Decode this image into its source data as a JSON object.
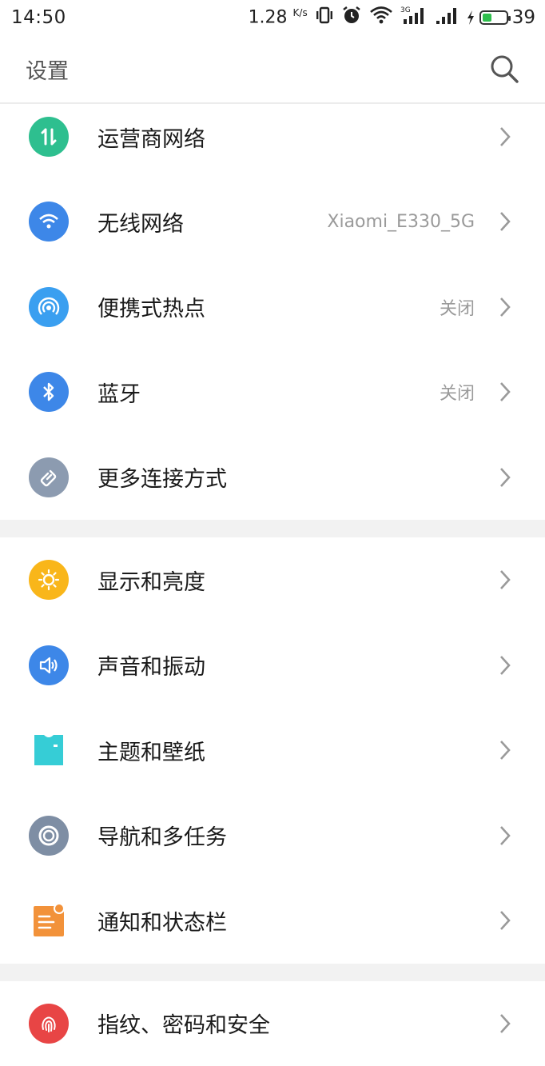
{
  "status_bar": {
    "time": "14:50",
    "speed": "1.28",
    "speed_unit": "K/s",
    "network_type": "3G",
    "battery_level": "39",
    "battery_fraction": 0.39,
    "icons": [
      "vibrate-icon",
      "alarm-icon",
      "wifi-icon",
      "signal-3g-icon",
      "signal-icon",
      "charging-icon",
      "battery-icon"
    ]
  },
  "header": {
    "title": "设置",
    "search_icon": "search-icon"
  },
  "sections": [
    {
      "items": [
        {
          "label": "运营商网络",
          "value": "",
          "icon": "carrier-network-icon",
          "color": "#2ebf8f"
        },
        {
          "label": "无线网络",
          "value": "Xiaomi_E330_5G",
          "icon": "wifi-icon",
          "color": "#3d87e8"
        },
        {
          "label": "便携式热点",
          "value": "关闭",
          "icon": "hotspot-icon",
          "color": "#3a9ff0"
        },
        {
          "label": "蓝牙",
          "value": "关闭",
          "icon": "bluetooth-icon",
          "color": "#3d87e8"
        },
        {
          "label": "更多连接方式",
          "value": "",
          "icon": "link-icon",
          "color": "#8c9bb0"
        }
      ]
    },
    {
      "items": [
        {
          "label": "显示和亮度",
          "value": "",
          "icon": "brightness-icon",
          "color": "#f9b61a"
        },
        {
          "label": "声音和振动",
          "value": "",
          "icon": "sound-icon",
          "color": "#3d87e8"
        },
        {
          "label": "主题和壁纸",
          "value": "",
          "icon": "theme-icon",
          "color": "#36cdd6"
        },
        {
          "label": "导航和多任务",
          "value": "",
          "icon": "navigation-icon",
          "color": "#7e8ea4"
        },
        {
          "label": "通知和状态栏",
          "value": "",
          "icon": "notification-icon",
          "color": "#f2923a"
        }
      ]
    },
    {
      "items": [
        {
          "label": "指纹、密码和安全",
          "value": "",
          "icon": "fingerprint-icon",
          "color": "#e84545"
        }
      ]
    }
  ]
}
